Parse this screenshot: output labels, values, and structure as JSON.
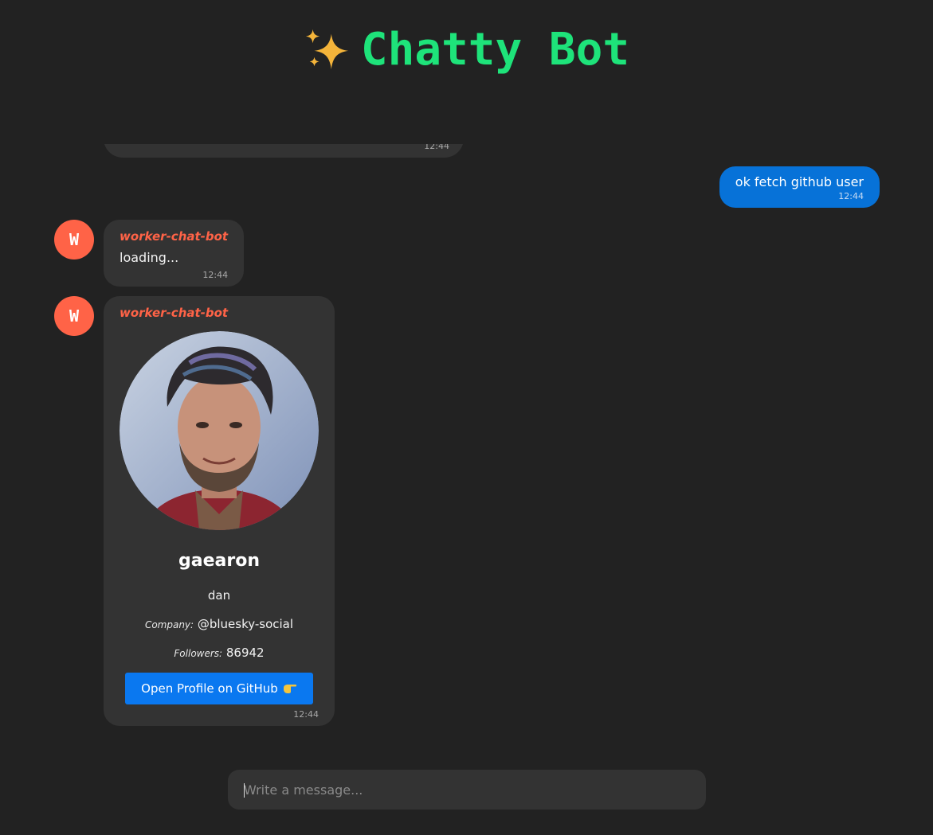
{
  "app": {
    "title": "Chatty Bot",
    "title_icon": "sparkles-icon",
    "accent": "#1ee37a"
  },
  "messages": [
    {
      "kind": "bot-partial",
      "time": "12:44"
    },
    {
      "kind": "user",
      "text": "ok fetch github user",
      "time": "12:44"
    },
    {
      "kind": "bot",
      "avatar_letter": "W",
      "author": "worker-chat-bot",
      "text": "loading...",
      "time": "12:44"
    },
    {
      "kind": "bot-card",
      "avatar_letter": "W",
      "author": "worker-chat-bot",
      "time": "12:44",
      "card": {
        "username": "gaearon",
        "name": "dan",
        "company_label": "Company:",
        "company": "@bluesky-social",
        "followers_label": "Followers:",
        "followers": "86942",
        "button_label": "Open Profile on GitHub",
        "button_icon": "pointing-hand-icon"
      }
    }
  ],
  "composer": {
    "placeholder": "Write a message...",
    "value": ""
  },
  "colors": {
    "background": "#222222",
    "bubble": "#333333",
    "user_bubble": "#0772d8",
    "bot_avatar": "#ff6347",
    "button": "#0a78f0"
  }
}
